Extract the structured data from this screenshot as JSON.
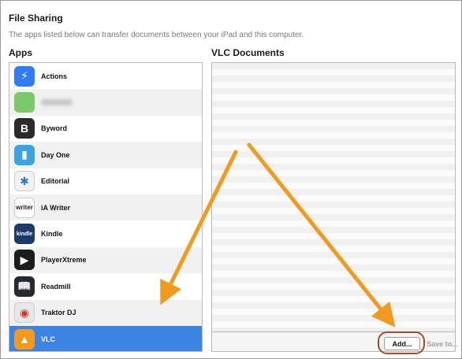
{
  "header": {
    "title": "File Sharing",
    "subtitle": "The apps listed below can transfer documents between your iPad and this computer."
  },
  "apps_panel": {
    "heading": "Apps",
    "items": [
      {
        "label": "Actions",
        "icon": "lightning-icon",
        "icon_color": "#2f7df6",
        "glyph": "⚡"
      },
      {
        "label": "",
        "icon": "blurred-app-icon",
        "icon_color": "#7cc96a",
        "glyph": ""
      },
      {
        "label": "Byword",
        "icon": "byword-b-icon",
        "icon_color": "#2b2b2b",
        "glyph": "B"
      },
      {
        "label": "Day One",
        "icon": "bookmark-icon",
        "icon_color": "#3aa4e0",
        "glyph": "▮"
      },
      {
        "label": "Editorial",
        "icon": "asterisk-icon",
        "icon_color": "#f2f2f2",
        "glyph": "✱"
      },
      {
        "label": "iA Writer",
        "icon": "writer-icon",
        "icon_color": "#ffffff",
        "glyph": "writer"
      },
      {
        "label": "Kindle",
        "icon": "kindle-icon",
        "icon_color": "#1d3b6a",
        "glyph": "kindle"
      },
      {
        "label": "PlayerXtreme",
        "icon": "play-icon",
        "icon_color": "#1c1c1c",
        "glyph": "▶"
      },
      {
        "label": "Readmill",
        "icon": "book-icon",
        "icon_color": "#222a33",
        "glyph": "📖"
      },
      {
        "label": "Traktor DJ",
        "icon": "traktor-icon",
        "icon_color": "#e8e8e8",
        "glyph": "◉"
      },
      {
        "label": "VLC",
        "icon": "traffic-cone-icon",
        "icon_color": "#f39a1e",
        "glyph": "▲"
      }
    ],
    "selected_index": 10
  },
  "documents_panel": {
    "heading": "VLC Documents",
    "add_label": "Add...",
    "save_label": "Save to..."
  },
  "colors": {
    "selection": "#3b84e4",
    "arrow": "#f29a1d",
    "highlight_ring": "#a84a2a"
  }
}
